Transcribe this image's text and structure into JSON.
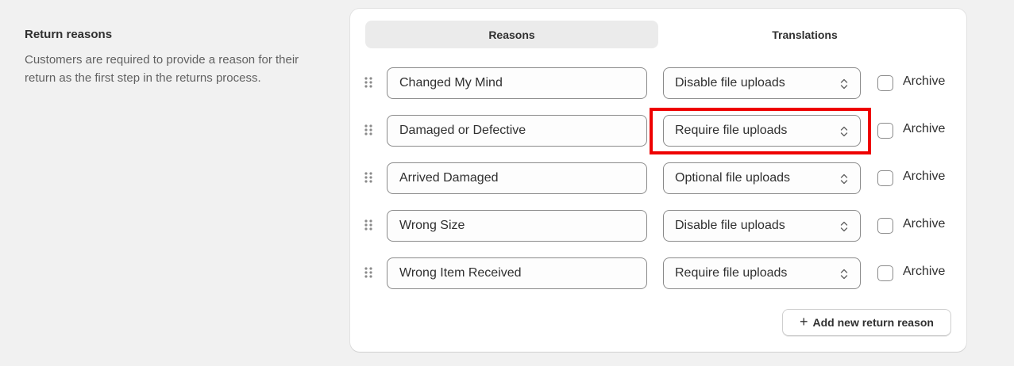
{
  "section": {
    "title": "Return reasons",
    "description": "Customers are required to provide a reason for their return as the first step in the returns process."
  },
  "tabs": [
    {
      "label": "Reasons",
      "active": true
    },
    {
      "label": "Translations",
      "active": false
    }
  ],
  "reasons": [
    {
      "name": "Changed My Mind",
      "file_upload": "Disable file uploads",
      "archive_label": "Archive",
      "archived": false
    },
    {
      "name": "Damaged or Defective",
      "file_upload": "Require file uploads",
      "archive_label": "Archive",
      "archived": false
    },
    {
      "name": "Arrived Damaged",
      "file_upload": "Optional file uploads",
      "archive_label": "Archive",
      "archived": false
    },
    {
      "name": "Wrong Size",
      "file_upload": "Disable file uploads",
      "archive_label": "Archive",
      "archived": false
    },
    {
      "name": "Wrong Item Received",
      "file_upload": "Require file uploads",
      "archive_label": "Archive",
      "archived": false
    }
  ],
  "add_button": {
    "icon": "plus-icon",
    "label": "Add new return reason"
  },
  "colors": {
    "highlight": "#ee0000",
    "active_tab": "#ebebeb",
    "page_bg": "#f1f1f1"
  }
}
